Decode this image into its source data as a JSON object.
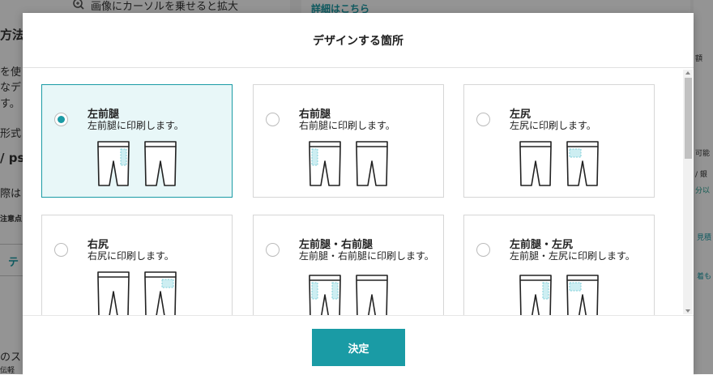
{
  "background": {
    "zoom_text": "画像にカーソルを乗せると拡大",
    "details_link": "詳細はこちら",
    "left_fragments": [
      "方法",
      "を使",
      "なデ",
      "す。",
      "形式",
      "/ ps",
      "際は",
      "注意点",
      "テ",
      "のス",
      "伝軽"
    ],
    "right_fragments": [
      "額",
      "可能",
      "/ 銀",
      "分以",
      "見積",
      "着も"
    ]
  },
  "modal": {
    "title": "デザインする箇所",
    "options": [
      {
        "label": "左前腿",
        "description": "左前腿に印刷します。",
        "selected": true,
        "front_marks": [
          "left-front"
        ],
        "back_marks": []
      },
      {
        "label": "右前腿",
        "description": "右前腿に印刷します。",
        "selected": false,
        "front_marks": [
          "right-front"
        ],
        "back_marks": []
      },
      {
        "label": "左尻",
        "description": "左尻に印刷します。",
        "selected": false,
        "front_marks": [],
        "back_marks": [
          "left-back"
        ]
      },
      {
        "label": "右尻",
        "description": "右尻に印刷します。",
        "selected": false,
        "front_marks": [],
        "back_marks": [
          "right-back"
        ]
      },
      {
        "label": "左前腿・右前腿",
        "description": "左前腿・右前腿に印刷します。",
        "selected": false,
        "front_marks": [
          "left-front",
          "right-front"
        ],
        "back_marks": []
      },
      {
        "label": "左前腿・左尻",
        "description": "左前腿・左尻に印刷します。",
        "selected": false,
        "front_marks": [
          "left-front"
        ],
        "back_marks": [
          "left-back"
        ]
      }
    ],
    "confirm_label": "決定"
  },
  "colors": {
    "accent": "#1a9ba5",
    "selected_bg": "#e8f7f8",
    "print_area": "#cdeef2"
  }
}
